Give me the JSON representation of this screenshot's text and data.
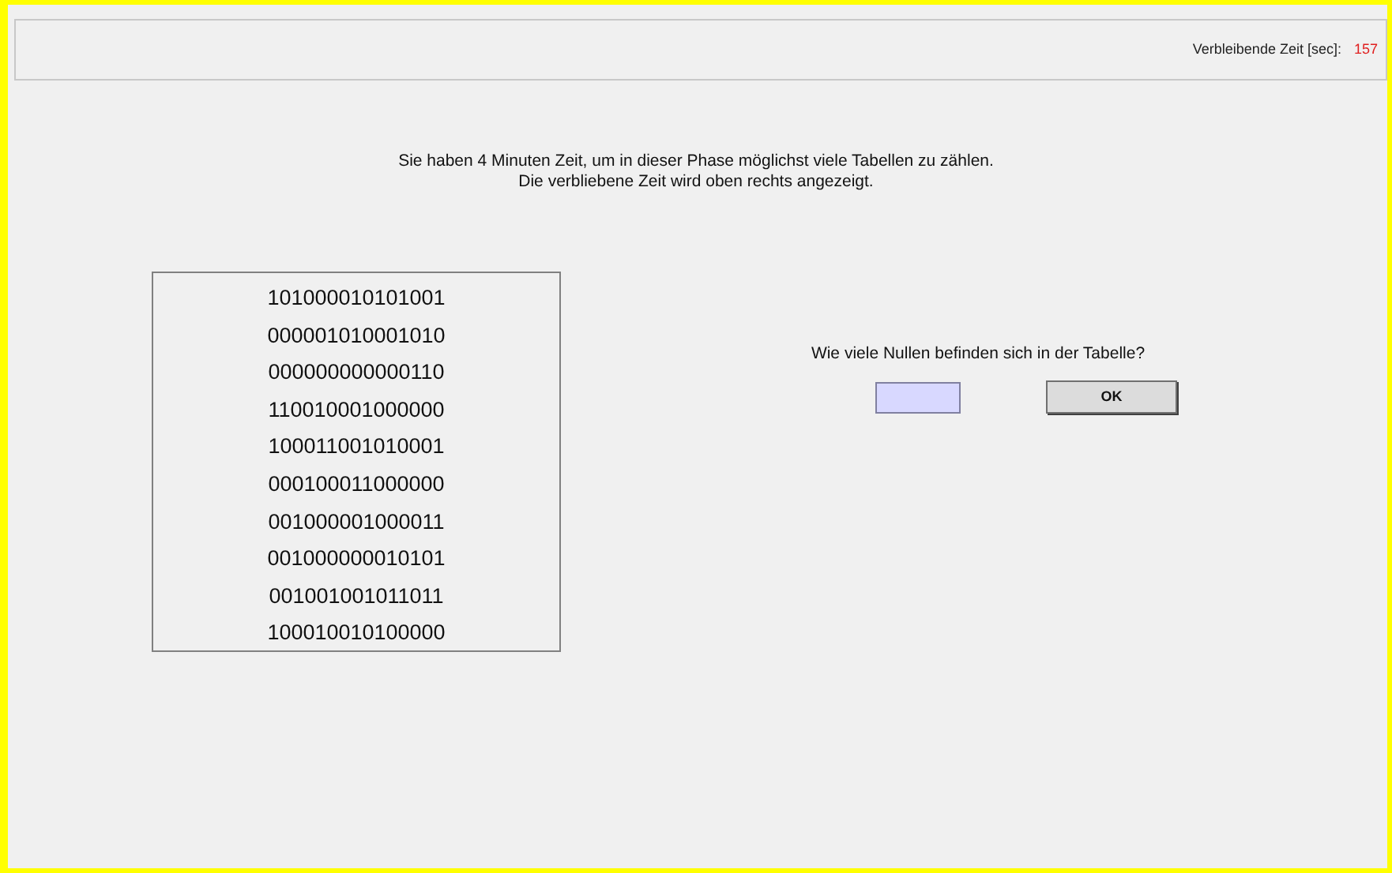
{
  "header": {
    "timer_label": "Verbleibende Zeit [sec]:",
    "timer_value": "157"
  },
  "instructions": [
    "Sie haben 4 Minuten Zeit, um in dieser Phase möglichst viele Tabellen zu zählen.",
    "Die verbliebene Zeit wird oben rechts angezeigt."
  ],
  "table": {
    "rows": [
      "101000010101001",
      "000001010001010",
      "000000000000110",
      "110010001000000",
      "100011001010001",
      "000100011000000",
      "001000001000011",
      "001000000010101",
      "001001001011011",
      "100010010100000"
    ]
  },
  "question": "Wie viele Nullen befinden sich in der Tabelle?",
  "button": "OK"
}
